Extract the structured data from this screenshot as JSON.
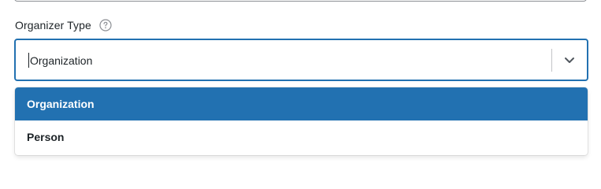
{
  "field": {
    "label": "Organizer Type",
    "help_icon": "question-circle-icon",
    "value": "Organization",
    "chevron_icon": "chevron-down-icon"
  },
  "dropdown": {
    "options": [
      {
        "label": "Organization",
        "selected": true
      },
      {
        "label": "Person",
        "selected": false
      }
    ]
  },
  "colors": {
    "accent": "#2271b1",
    "text": "#1d2327",
    "border_muted": "#8c8f94"
  }
}
